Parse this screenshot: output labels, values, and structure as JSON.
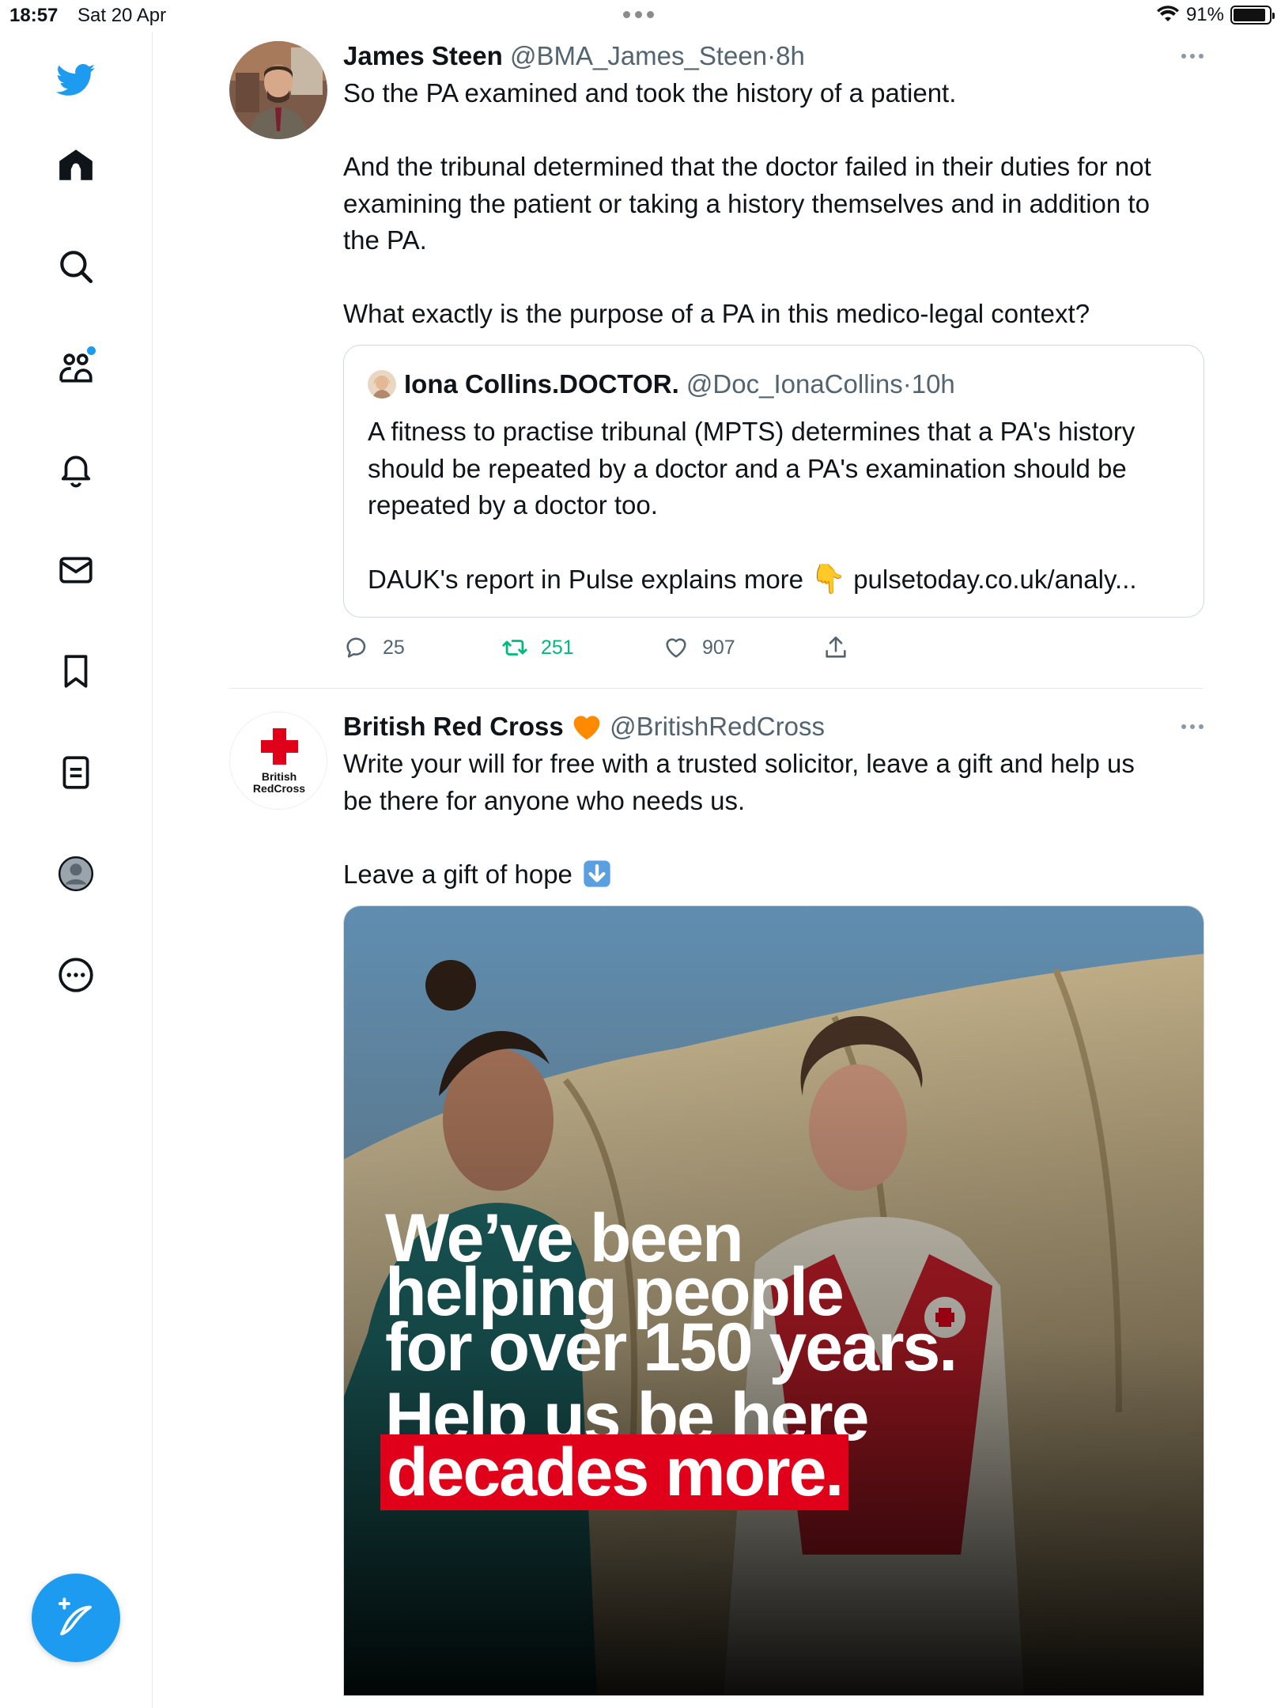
{
  "status_bar": {
    "time": "18:57",
    "date": "Sat 20 Apr",
    "battery": "91%",
    "battery_level": 0.91
  },
  "sidebar": {
    "items": [
      {
        "icon": "twitter-logo-icon"
      },
      {
        "icon": "home-icon"
      },
      {
        "icon": "search-icon"
      },
      {
        "icon": "communities-icon"
      },
      {
        "icon": "notifications-icon"
      },
      {
        "icon": "messages-icon"
      },
      {
        "icon": "bookmarks-icon"
      },
      {
        "icon": "lists-icon"
      },
      {
        "icon": "profile-icon"
      },
      {
        "icon": "more-icon"
      }
    ],
    "compose_icon": "compose-tweet-icon"
  },
  "colors": {
    "accent": "#1d9bf0",
    "retweet_active": "#00ba7c",
    "muted_text": "#536471",
    "border": "#cfd9de",
    "red_cross": "#e1001a",
    "heart_badge": "#ff8a00"
  },
  "tweets": [
    {
      "name": "James Steen",
      "handle": "@BMA_James_Steen",
      "separator": "·",
      "time": "8h",
      "text": {
        "line1": "So the PA examined and took the history of a patient.",
        "line2": "And the tribunal determined that the doctor failed in their duties for not",
        "line3": "examining the patient or taking a history themselves and in addition to",
        "line4": "the PA.",
        "line5": "What exactly is the purpose of a PA in this medico-legal context?"
      },
      "quote": {
        "name": "Iona Collins.DOCTOR.",
        "handle": "@Doc_IonaCollins",
        "separator": "·",
        "time": "10h",
        "line1": "A fitness to practise tribunal (MPTS) determines that a PA's history",
        "line2": "should be repeated by a doctor and a PA's examination should be",
        "line3": "repeated by a doctor too.",
        "line4_text": "DAUK's report in Pulse explains more",
        "line4_emoji": "👇",
        "link": "pulsetoday.co.uk/analy..."
      },
      "actions": {
        "replies": "25",
        "retweets": "251",
        "likes": "907"
      }
    },
    {
      "name": "British Red Cross",
      "handle": "@BritishRedCross",
      "avatar_text_line1": "British",
      "avatar_text_line2": "RedCross",
      "text": {
        "line1": "Write your will for free with a trusted solicitor, leave a gift and help us",
        "line2": "be there for anyone who needs us.",
        "line3": "Leave a gift of hope"
      },
      "media": {
        "headline_line1": "We’ve been",
        "headline_line2": "helping people",
        "headline_line3": "for over 150 years.",
        "headline_line4": "Help us be here",
        "headline_line5": "decades more."
      }
    }
  ]
}
